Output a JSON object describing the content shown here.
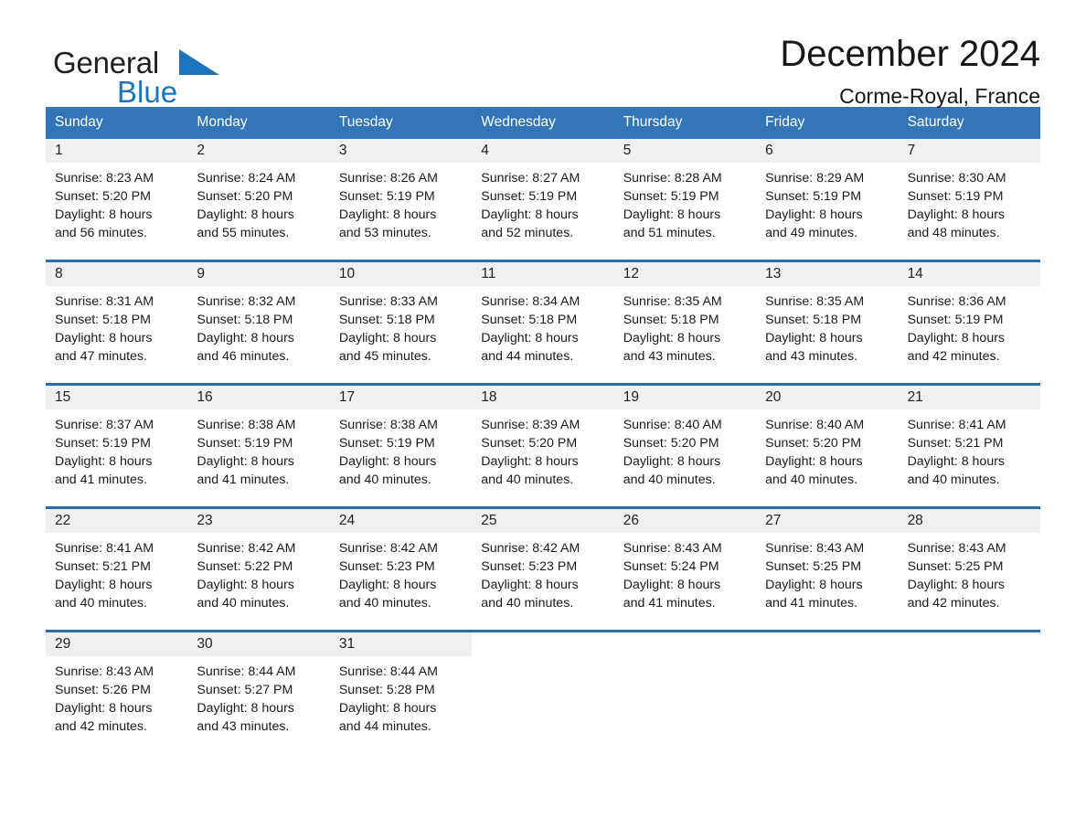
{
  "brand": {
    "name_part1": "General",
    "name_part2": "Blue",
    "logo_icon": "triangle-icon"
  },
  "header": {
    "month_title": "December 2024",
    "location": "Corme-Royal, France"
  },
  "colors": {
    "header_band": "#3276b8",
    "row_divider": "#2b6cab",
    "daynum_band": "#f0f0f0",
    "brand_blue": "#1c75bc"
  },
  "weekdays": [
    "Sunday",
    "Monday",
    "Tuesday",
    "Wednesday",
    "Thursday",
    "Friday",
    "Saturday"
  ],
  "weeks": [
    [
      {
        "day": "1",
        "sunrise": "Sunrise: 8:23 AM",
        "sunset": "Sunset: 5:20 PM",
        "daylight_line1": "Daylight: 8 hours",
        "daylight_line2": "and 56 minutes."
      },
      {
        "day": "2",
        "sunrise": "Sunrise: 8:24 AM",
        "sunset": "Sunset: 5:20 PM",
        "daylight_line1": "Daylight: 8 hours",
        "daylight_line2": "and 55 minutes."
      },
      {
        "day": "3",
        "sunrise": "Sunrise: 8:26 AM",
        "sunset": "Sunset: 5:19 PM",
        "daylight_line1": "Daylight: 8 hours",
        "daylight_line2": "and 53 minutes."
      },
      {
        "day": "4",
        "sunrise": "Sunrise: 8:27 AM",
        "sunset": "Sunset: 5:19 PM",
        "daylight_line1": "Daylight: 8 hours",
        "daylight_line2": "and 52 minutes."
      },
      {
        "day": "5",
        "sunrise": "Sunrise: 8:28 AM",
        "sunset": "Sunset: 5:19 PM",
        "daylight_line1": "Daylight: 8 hours",
        "daylight_line2": "and 51 minutes."
      },
      {
        "day": "6",
        "sunrise": "Sunrise: 8:29 AM",
        "sunset": "Sunset: 5:19 PM",
        "daylight_line1": "Daylight: 8 hours",
        "daylight_line2": "and 49 minutes."
      },
      {
        "day": "7",
        "sunrise": "Sunrise: 8:30 AM",
        "sunset": "Sunset: 5:19 PM",
        "daylight_line1": "Daylight: 8 hours",
        "daylight_line2": "and 48 minutes."
      }
    ],
    [
      {
        "day": "8",
        "sunrise": "Sunrise: 8:31 AM",
        "sunset": "Sunset: 5:18 PM",
        "daylight_line1": "Daylight: 8 hours",
        "daylight_line2": "and 47 minutes."
      },
      {
        "day": "9",
        "sunrise": "Sunrise: 8:32 AM",
        "sunset": "Sunset: 5:18 PM",
        "daylight_line1": "Daylight: 8 hours",
        "daylight_line2": "and 46 minutes."
      },
      {
        "day": "10",
        "sunrise": "Sunrise: 8:33 AM",
        "sunset": "Sunset: 5:18 PM",
        "daylight_line1": "Daylight: 8 hours",
        "daylight_line2": "and 45 minutes."
      },
      {
        "day": "11",
        "sunrise": "Sunrise: 8:34 AM",
        "sunset": "Sunset: 5:18 PM",
        "daylight_line1": "Daylight: 8 hours",
        "daylight_line2": "and 44 minutes."
      },
      {
        "day": "12",
        "sunrise": "Sunrise: 8:35 AM",
        "sunset": "Sunset: 5:18 PM",
        "daylight_line1": "Daylight: 8 hours",
        "daylight_line2": "and 43 minutes."
      },
      {
        "day": "13",
        "sunrise": "Sunrise: 8:35 AM",
        "sunset": "Sunset: 5:18 PM",
        "daylight_line1": "Daylight: 8 hours",
        "daylight_line2": "and 43 minutes."
      },
      {
        "day": "14",
        "sunrise": "Sunrise: 8:36 AM",
        "sunset": "Sunset: 5:19 PM",
        "daylight_line1": "Daylight: 8 hours",
        "daylight_line2": "and 42 minutes."
      }
    ],
    [
      {
        "day": "15",
        "sunrise": "Sunrise: 8:37 AM",
        "sunset": "Sunset: 5:19 PM",
        "daylight_line1": "Daylight: 8 hours",
        "daylight_line2": "and 41 minutes."
      },
      {
        "day": "16",
        "sunrise": "Sunrise: 8:38 AM",
        "sunset": "Sunset: 5:19 PM",
        "daylight_line1": "Daylight: 8 hours",
        "daylight_line2": "and 41 minutes."
      },
      {
        "day": "17",
        "sunrise": "Sunrise: 8:38 AM",
        "sunset": "Sunset: 5:19 PM",
        "daylight_line1": "Daylight: 8 hours",
        "daylight_line2": "and 40 minutes."
      },
      {
        "day": "18",
        "sunrise": "Sunrise: 8:39 AM",
        "sunset": "Sunset: 5:20 PM",
        "daylight_line1": "Daylight: 8 hours",
        "daylight_line2": "and 40 minutes."
      },
      {
        "day": "19",
        "sunrise": "Sunrise: 8:40 AM",
        "sunset": "Sunset: 5:20 PM",
        "daylight_line1": "Daylight: 8 hours",
        "daylight_line2": "and 40 minutes."
      },
      {
        "day": "20",
        "sunrise": "Sunrise: 8:40 AM",
        "sunset": "Sunset: 5:20 PM",
        "daylight_line1": "Daylight: 8 hours",
        "daylight_line2": "and 40 minutes."
      },
      {
        "day": "21",
        "sunrise": "Sunrise: 8:41 AM",
        "sunset": "Sunset: 5:21 PM",
        "daylight_line1": "Daylight: 8 hours",
        "daylight_line2": "and 40 minutes."
      }
    ],
    [
      {
        "day": "22",
        "sunrise": "Sunrise: 8:41 AM",
        "sunset": "Sunset: 5:21 PM",
        "daylight_line1": "Daylight: 8 hours",
        "daylight_line2": "and 40 minutes."
      },
      {
        "day": "23",
        "sunrise": "Sunrise: 8:42 AM",
        "sunset": "Sunset: 5:22 PM",
        "daylight_line1": "Daylight: 8 hours",
        "daylight_line2": "and 40 minutes."
      },
      {
        "day": "24",
        "sunrise": "Sunrise: 8:42 AM",
        "sunset": "Sunset: 5:23 PM",
        "daylight_line1": "Daylight: 8 hours",
        "daylight_line2": "and 40 minutes."
      },
      {
        "day": "25",
        "sunrise": "Sunrise: 8:42 AM",
        "sunset": "Sunset: 5:23 PM",
        "daylight_line1": "Daylight: 8 hours",
        "daylight_line2": "and 40 minutes."
      },
      {
        "day": "26",
        "sunrise": "Sunrise: 8:43 AM",
        "sunset": "Sunset: 5:24 PM",
        "daylight_line1": "Daylight: 8 hours",
        "daylight_line2": "and 41 minutes."
      },
      {
        "day": "27",
        "sunrise": "Sunrise: 8:43 AM",
        "sunset": "Sunset: 5:25 PM",
        "daylight_line1": "Daylight: 8 hours",
        "daylight_line2": "and 41 minutes."
      },
      {
        "day": "28",
        "sunrise": "Sunrise: 8:43 AM",
        "sunset": "Sunset: 5:25 PM",
        "daylight_line1": "Daylight: 8 hours",
        "daylight_line2": "and 42 minutes."
      }
    ],
    [
      {
        "day": "29",
        "sunrise": "Sunrise: 8:43 AM",
        "sunset": "Sunset: 5:26 PM",
        "daylight_line1": "Daylight: 8 hours",
        "daylight_line2": "and 42 minutes."
      },
      {
        "day": "30",
        "sunrise": "Sunrise: 8:44 AM",
        "sunset": "Sunset: 5:27 PM",
        "daylight_line1": "Daylight: 8 hours",
        "daylight_line2": "and 43 minutes."
      },
      {
        "day": "31",
        "sunrise": "Sunrise: 8:44 AM",
        "sunset": "Sunset: 5:28 PM",
        "daylight_line1": "Daylight: 8 hours",
        "daylight_line2": "and 44 minutes."
      },
      {
        "day": "",
        "sunrise": "",
        "sunset": "",
        "daylight_line1": "",
        "daylight_line2": ""
      },
      {
        "day": "",
        "sunrise": "",
        "sunset": "",
        "daylight_line1": "",
        "daylight_line2": ""
      },
      {
        "day": "",
        "sunrise": "",
        "sunset": "",
        "daylight_line1": "",
        "daylight_line2": ""
      },
      {
        "day": "",
        "sunrise": "",
        "sunset": "",
        "daylight_line1": "",
        "daylight_line2": ""
      }
    ]
  ]
}
